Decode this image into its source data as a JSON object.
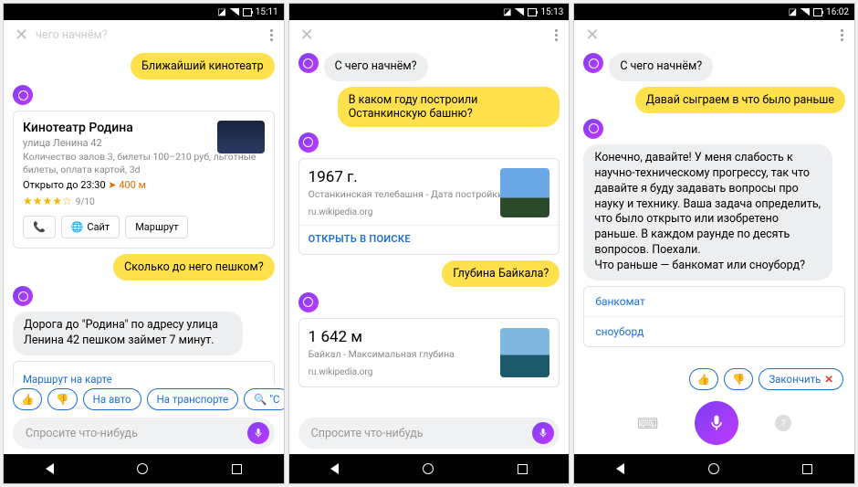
{
  "phones": [
    {
      "status_time": "15:11",
      "header_placeholder": "чего начнём?",
      "user_msg_1": "Ближайший кинотеатр",
      "cinema": {
        "title": "Кинотеатр Родина",
        "address": "улица Ленина 42",
        "details": "Количество залов 3, билеты 100–210 руб, льготные билеты, оплата картой, 3d",
        "open": "Открыто до 23:30",
        "distance": "400 м",
        "stars": "★★★★☆",
        "rating": "9/10",
        "site_label": "Сайт",
        "route_label": "Маршрут"
      },
      "user_msg_2": "Сколько до него пешком?",
      "bot_reply": "Дорога до \"Родина\" по адресу улица Ленина 42 пешком займет 7 минут.",
      "route_link": "Маршрут на карте",
      "chips": [
        "👍",
        "👎",
        "На авто",
        "На транспорте",
        "🔍 \"С"
      ],
      "input_placeholder": "Спросите что-нибудь"
    },
    {
      "status_time": "15:13",
      "bot_greet": "С чего начнём?",
      "user_msg_1": "В каком году построили Останкинскую башню?",
      "fact1": {
        "answer": "1967 г.",
        "caption": "Останкинская телебашня - Дата постройки",
        "source": "ru.wikipedia.org",
        "open": "ОТКРЫТЬ В ПОИСКЕ"
      },
      "user_msg_2": "Глубина Байкала?",
      "fact2": {
        "answer": "1 642 м",
        "caption": "Байкал - Максимальная глубина",
        "source": "ru.wikipedia.org"
      },
      "input_placeholder": "Спросите что-нибудь"
    },
    {
      "status_time": "16:02",
      "bot_greet": "С чего начнём?",
      "user_msg_1": "Давай сыграем в что было раньше",
      "bot_reply": "Конечно, давайте! У меня слабость к научно-техническому прогрессу, так что давайте я буду задавать вопросы про науку и технику. Ваша задача определить, что было открыто или изобретено раньше. В каждом раунде по десять вопросов. Поехали.\nЧто раньше — банкомат или сноуборд?",
      "quick_replies": [
        "банкомат",
        "сноуборд"
      ],
      "chips": [
        "👍",
        "👎"
      ],
      "finish_label": "Закончить"
    }
  ]
}
